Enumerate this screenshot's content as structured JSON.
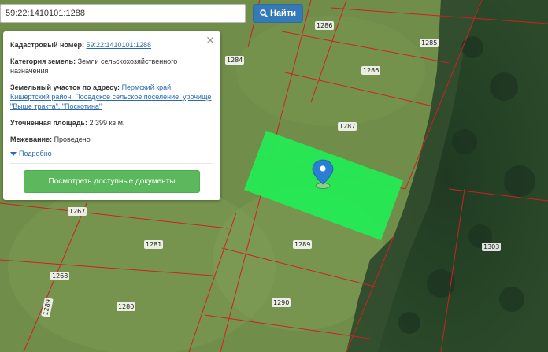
{
  "search": {
    "value": "59:22:1410101:1288",
    "button_label": "Найти"
  },
  "card": {
    "cadastral_label": "Кадастровый номер:",
    "cadastral_value": "59:22:1410101:1288",
    "category_label": "Категория земель:",
    "category_value": "Земли сельскохозяйственного назначения",
    "address_label": "Земельный участок по адресу:",
    "address_value": "Пермский край, Кишертский район, Посадское сельское поселение, урочище \"Выше тракта\", \"Поскотина\"",
    "area_label": "Уточненная площадь:",
    "area_value": "2 399 кв.м.",
    "survey_label": "Межевание:",
    "survey_value": "Проведено",
    "more_label": "Подробно",
    "docs_button": "Посмотреть доступные документы",
    "close_icon": "close-icon"
  },
  "map": {
    "parcel_labels": [
      "1286",
      "1285",
      "1284",
      "1286",
      "1287",
      "1267",
      "1281",
      "1289",
      "1303",
      "1268",
      "1280",
      "1290",
      "1289"
    ],
    "highlight_color": "#22ee55",
    "boundary_color": "#cc2222",
    "marker_color": "#2a7fd4"
  }
}
